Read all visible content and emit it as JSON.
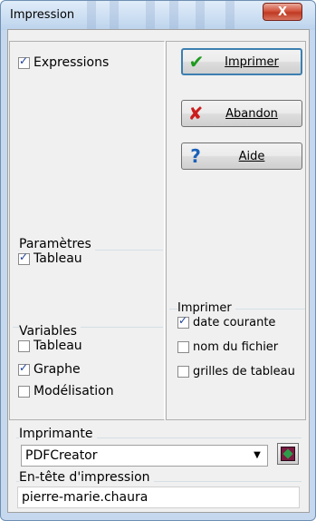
{
  "window": {
    "title": "Impression",
    "close_label": "X"
  },
  "left": {
    "expressions": {
      "label": "Expressions",
      "checked": true
    },
    "parametres": {
      "legend": "Paramètres",
      "tableau": {
        "label": "Tableau",
        "checked": true
      }
    },
    "variables": {
      "legend": "Variables",
      "items": [
        {
          "label": "Tableau",
          "checked": false
        },
        {
          "label": "Graphe",
          "checked": true
        },
        {
          "label": "Modélisation",
          "checked": false
        }
      ]
    }
  },
  "right": {
    "buttons": {
      "imprimer": "Imprimer",
      "abandon": "Abandon",
      "aide": "Aide"
    },
    "imprimer_group": {
      "legend": "Imprimer",
      "items": [
        {
          "label": "date courante",
          "checked": true
        },
        {
          "label": "nom du fichier",
          "checked": false
        },
        {
          "label": "grilles de tableau",
          "checked": false
        }
      ]
    }
  },
  "bottom": {
    "imprimante_label": "Imprimante",
    "imprimante_value": "PDFCreator",
    "entete_label": "En-tête d'impression",
    "entete_value": "pierre-marie.chaura"
  },
  "icons": {
    "check": "check-icon",
    "cross": "cross-icon",
    "help": "help-icon",
    "printer_setup": "printer-setup-icon",
    "dropdown": "chevron-down-icon"
  }
}
